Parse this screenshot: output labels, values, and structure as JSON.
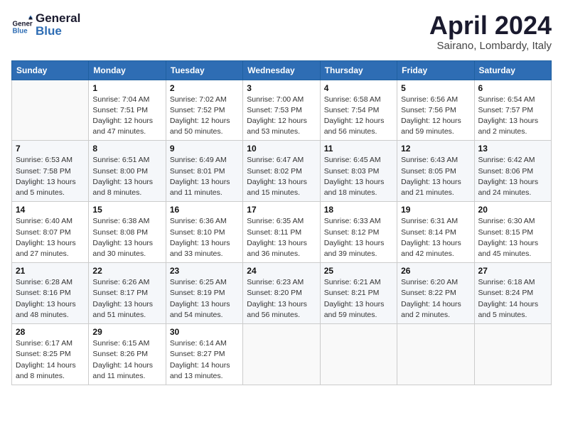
{
  "header": {
    "logo_line1": "General",
    "logo_line2": "Blue",
    "month_title": "April 2024",
    "location": "Sairano, Lombardy, Italy"
  },
  "weekdays": [
    "Sunday",
    "Monday",
    "Tuesday",
    "Wednesday",
    "Thursday",
    "Friday",
    "Saturday"
  ],
  "weeks": [
    [
      {
        "day": "",
        "sunrise": "",
        "sunset": "",
        "daylight": ""
      },
      {
        "day": "1",
        "sunrise": "7:04 AM",
        "sunset": "7:51 PM",
        "daylight": "12 hours and 47 minutes."
      },
      {
        "day": "2",
        "sunrise": "7:02 AM",
        "sunset": "7:52 PM",
        "daylight": "12 hours and 50 minutes."
      },
      {
        "day": "3",
        "sunrise": "7:00 AM",
        "sunset": "7:53 PM",
        "daylight": "12 hours and 53 minutes."
      },
      {
        "day": "4",
        "sunrise": "6:58 AM",
        "sunset": "7:54 PM",
        "daylight": "12 hours and 56 minutes."
      },
      {
        "day": "5",
        "sunrise": "6:56 AM",
        "sunset": "7:56 PM",
        "daylight": "12 hours and 59 minutes."
      },
      {
        "day": "6",
        "sunrise": "6:54 AM",
        "sunset": "7:57 PM",
        "daylight": "13 hours and 2 minutes."
      }
    ],
    [
      {
        "day": "7",
        "sunrise": "6:53 AM",
        "sunset": "7:58 PM",
        "daylight": "13 hours and 5 minutes."
      },
      {
        "day": "8",
        "sunrise": "6:51 AM",
        "sunset": "8:00 PM",
        "daylight": "13 hours and 8 minutes."
      },
      {
        "day": "9",
        "sunrise": "6:49 AM",
        "sunset": "8:01 PM",
        "daylight": "13 hours and 11 minutes."
      },
      {
        "day": "10",
        "sunrise": "6:47 AM",
        "sunset": "8:02 PM",
        "daylight": "13 hours and 15 minutes."
      },
      {
        "day": "11",
        "sunrise": "6:45 AM",
        "sunset": "8:03 PM",
        "daylight": "13 hours and 18 minutes."
      },
      {
        "day": "12",
        "sunrise": "6:43 AM",
        "sunset": "8:05 PM",
        "daylight": "13 hours and 21 minutes."
      },
      {
        "day": "13",
        "sunrise": "6:42 AM",
        "sunset": "8:06 PM",
        "daylight": "13 hours and 24 minutes."
      }
    ],
    [
      {
        "day": "14",
        "sunrise": "6:40 AM",
        "sunset": "8:07 PM",
        "daylight": "13 hours and 27 minutes."
      },
      {
        "day": "15",
        "sunrise": "6:38 AM",
        "sunset": "8:08 PM",
        "daylight": "13 hours and 30 minutes."
      },
      {
        "day": "16",
        "sunrise": "6:36 AM",
        "sunset": "8:10 PM",
        "daylight": "13 hours and 33 minutes."
      },
      {
        "day": "17",
        "sunrise": "6:35 AM",
        "sunset": "8:11 PM",
        "daylight": "13 hours and 36 minutes."
      },
      {
        "day": "18",
        "sunrise": "6:33 AM",
        "sunset": "8:12 PM",
        "daylight": "13 hours and 39 minutes."
      },
      {
        "day": "19",
        "sunrise": "6:31 AM",
        "sunset": "8:14 PM",
        "daylight": "13 hours and 42 minutes."
      },
      {
        "day": "20",
        "sunrise": "6:30 AM",
        "sunset": "8:15 PM",
        "daylight": "13 hours and 45 minutes."
      }
    ],
    [
      {
        "day": "21",
        "sunrise": "6:28 AM",
        "sunset": "8:16 PM",
        "daylight": "13 hours and 48 minutes."
      },
      {
        "day": "22",
        "sunrise": "6:26 AM",
        "sunset": "8:17 PM",
        "daylight": "13 hours and 51 minutes."
      },
      {
        "day": "23",
        "sunrise": "6:25 AM",
        "sunset": "8:19 PM",
        "daylight": "13 hours and 54 minutes."
      },
      {
        "day": "24",
        "sunrise": "6:23 AM",
        "sunset": "8:20 PM",
        "daylight": "13 hours and 56 minutes."
      },
      {
        "day": "25",
        "sunrise": "6:21 AM",
        "sunset": "8:21 PM",
        "daylight": "13 hours and 59 minutes."
      },
      {
        "day": "26",
        "sunrise": "6:20 AM",
        "sunset": "8:22 PM",
        "daylight": "14 hours and 2 minutes."
      },
      {
        "day": "27",
        "sunrise": "6:18 AM",
        "sunset": "8:24 PM",
        "daylight": "14 hours and 5 minutes."
      }
    ],
    [
      {
        "day": "28",
        "sunrise": "6:17 AM",
        "sunset": "8:25 PM",
        "daylight": "14 hours and 8 minutes."
      },
      {
        "day": "29",
        "sunrise": "6:15 AM",
        "sunset": "8:26 PM",
        "daylight": "14 hours and 11 minutes."
      },
      {
        "day": "30",
        "sunrise": "6:14 AM",
        "sunset": "8:27 PM",
        "daylight": "14 hours and 13 minutes."
      },
      {
        "day": "",
        "sunrise": "",
        "sunset": "",
        "daylight": ""
      },
      {
        "day": "",
        "sunrise": "",
        "sunset": "",
        "daylight": ""
      },
      {
        "day": "",
        "sunrise": "",
        "sunset": "",
        "daylight": ""
      },
      {
        "day": "",
        "sunrise": "",
        "sunset": "",
        "daylight": ""
      }
    ]
  ]
}
